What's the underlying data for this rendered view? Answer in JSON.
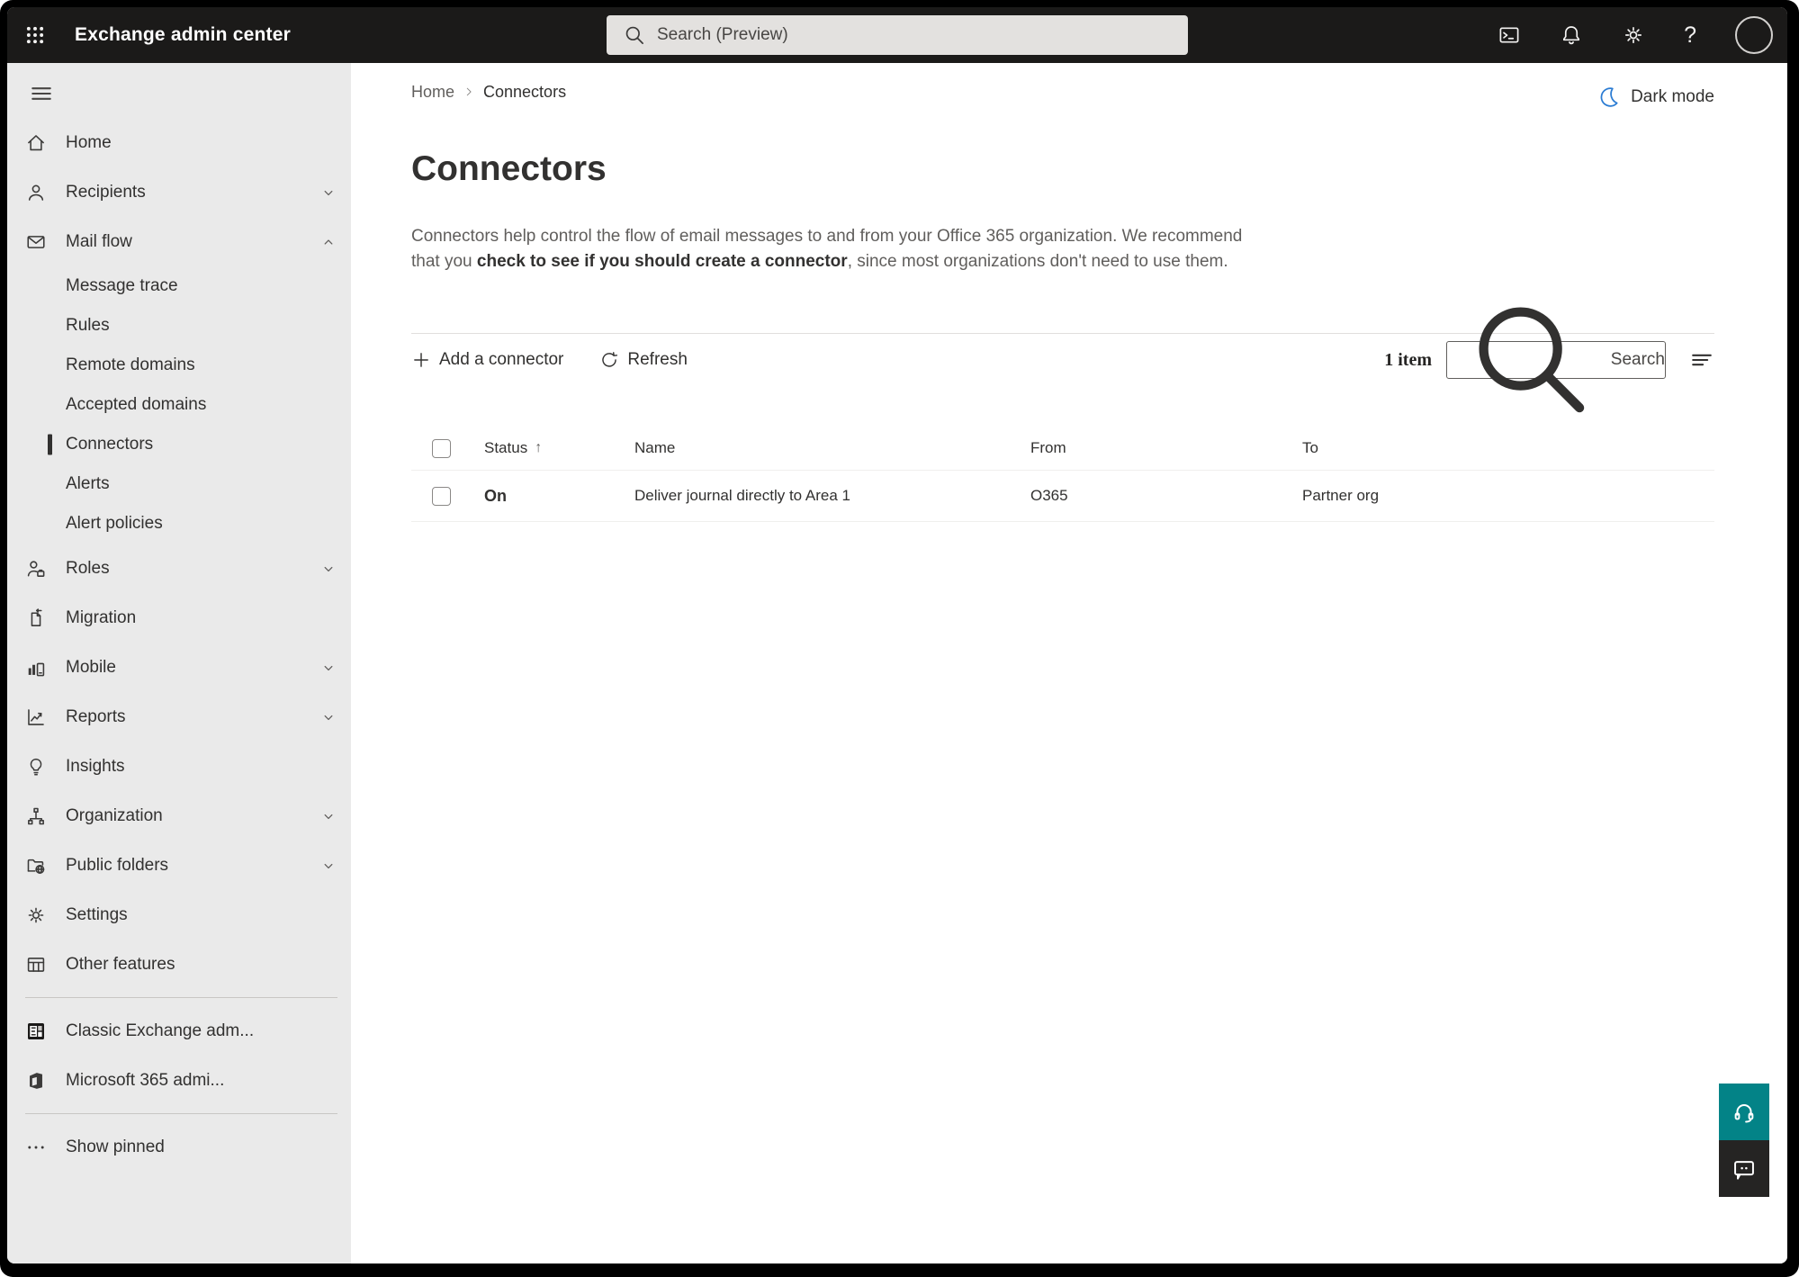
{
  "topbar": {
    "title": "Exchange admin center",
    "search_placeholder": "Search (Preview)"
  },
  "sidebar": {
    "items": [
      {
        "label": "Home",
        "icon": "home"
      },
      {
        "label": "Recipients",
        "icon": "recipients",
        "chevron": "down"
      },
      {
        "label": "Mail flow",
        "icon": "mail-flow",
        "chevron": "up"
      },
      {
        "label": "Message trace",
        "sub": true
      },
      {
        "label": "Rules",
        "sub": true
      },
      {
        "label": "Remote domains",
        "sub": true
      },
      {
        "label": "Accepted domains",
        "sub": true
      },
      {
        "label": "Connectors",
        "sub": true,
        "selected": true
      },
      {
        "label": "Alerts",
        "sub": true
      },
      {
        "label": "Alert policies",
        "sub": true
      },
      {
        "label": "Roles",
        "icon": "roles",
        "chevron": "down"
      },
      {
        "label": "Migration",
        "icon": "migration"
      },
      {
        "label": "Mobile",
        "icon": "mobile",
        "chevron": "down"
      },
      {
        "label": "Reports",
        "icon": "reports",
        "chevron": "down"
      },
      {
        "label": "Insights",
        "icon": "insights"
      },
      {
        "label": "Organization",
        "icon": "organization",
        "chevron": "down"
      },
      {
        "label": "Public folders",
        "icon": "public-folders",
        "chevron": "down"
      },
      {
        "label": "Settings",
        "icon": "settings"
      },
      {
        "label": "Other features",
        "icon": "other-features"
      },
      {
        "divider": true
      },
      {
        "label": "Classic Exchange adm...",
        "icon": "classic-exchange"
      },
      {
        "label": "Microsoft 365 admi...",
        "icon": "microsoft-365"
      },
      {
        "divider": true
      },
      {
        "label": "Show pinned",
        "icon": "show-pinned"
      }
    ]
  },
  "breadcrumb": {
    "items": [
      "Home",
      "Connectors"
    ]
  },
  "dark_mode_label": "Dark mode",
  "page": {
    "title": "Connectors",
    "description_1": "Connectors help control the flow of email messages to and from your Office 365 organization. We recommend that you ",
    "description_link": "check to see if you should create a connector",
    "description_2": ", since most organizations don't need to use them."
  },
  "toolbar": {
    "add_label": "Add a connector",
    "refresh_label": "Refresh",
    "item_count": "1 item",
    "search_placeholder": "Search"
  },
  "table": {
    "headers": [
      "Status",
      "Name",
      "From",
      "To"
    ],
    "sort_column": "Status",
    "sort_direction": "asc",
    "rows": [
      {
        "status": "On",
        "name": "Deliver journal directly to Area 1",
        "from": "O365",
        "to": "Partner org"
      }
    ]
  },
  "colors": {
    "accent_teal": "#038387",
    "feedback_dark": "#252423",
    "moon_blue": "#2b7cd3",
    "topbar_bg": "#1b1a19",
    "sidebar_bg": "#eaeaea"
  }
}
